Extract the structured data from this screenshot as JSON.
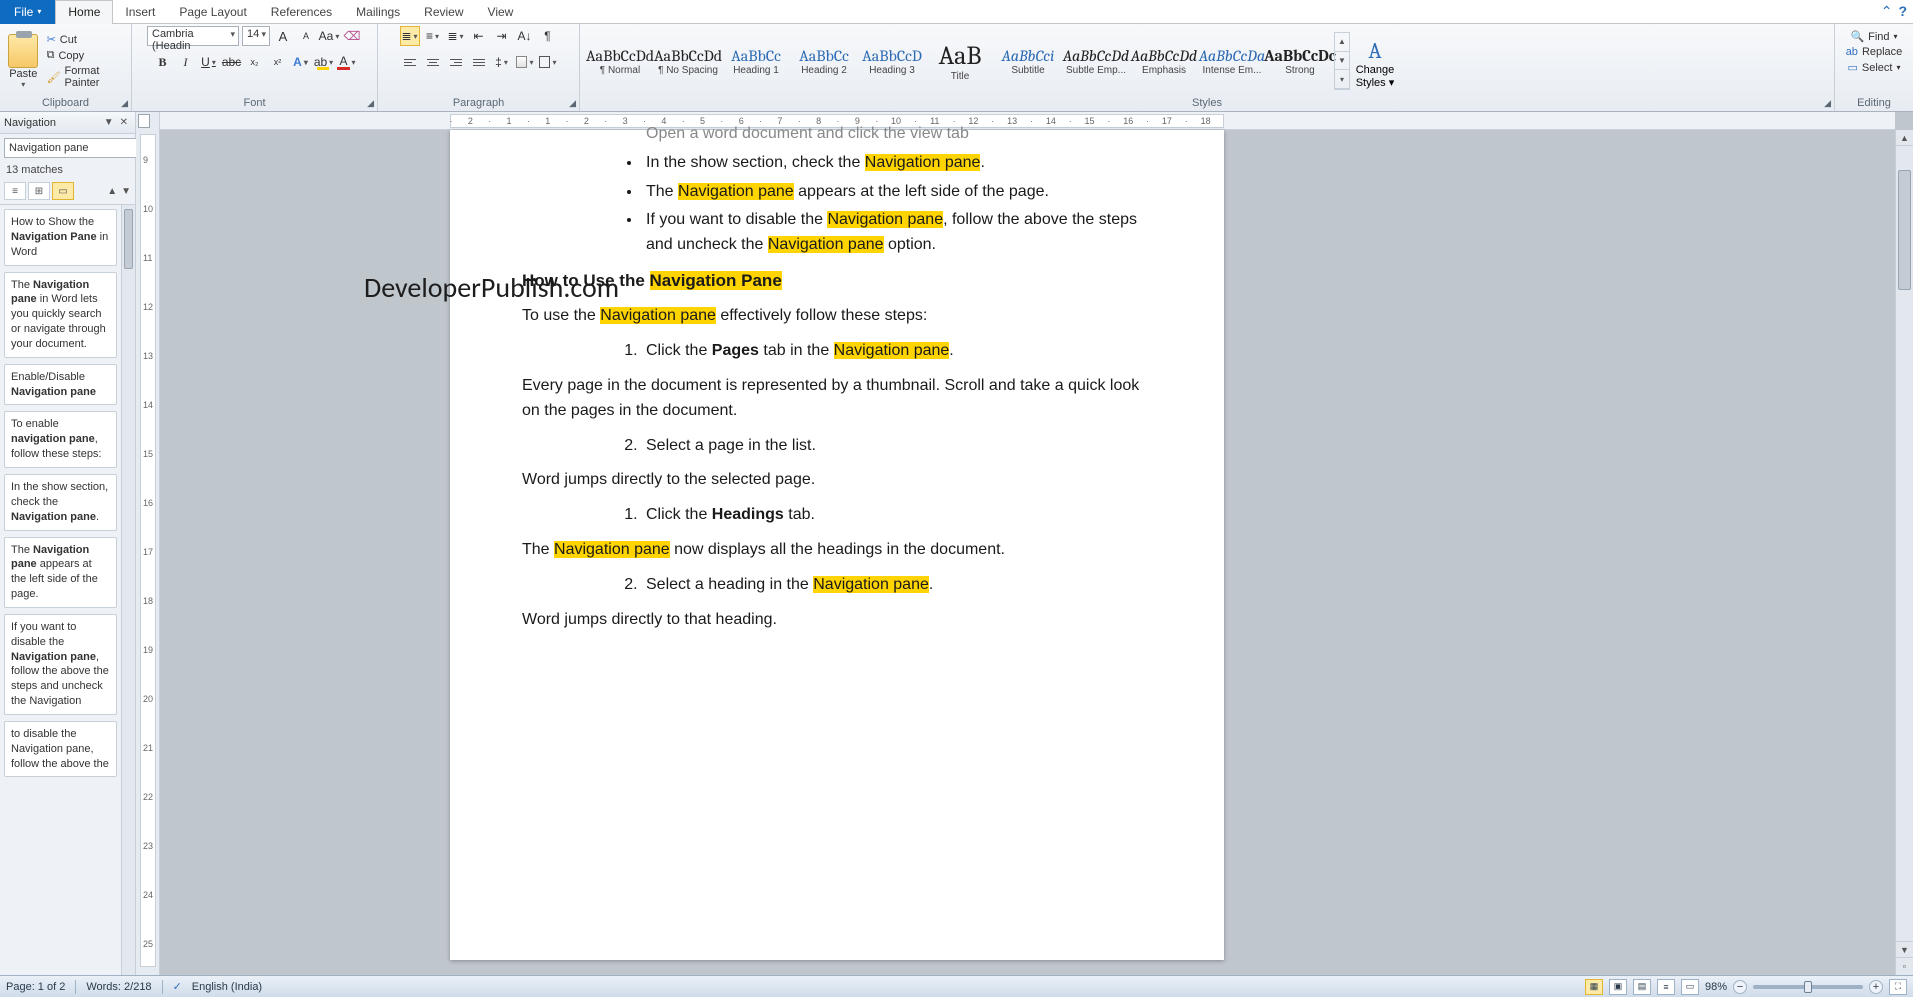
{
  "menu": {
    "file": "File",
    "tabs": [
      "Home",
      "Insert",
      "Page Layout",
      "References",
      "Mailings",
      "Review",
      "View"
    ],
    "active": "Home"
  },
  "ribbon": {
    "clipboard": {
      "label": "Clipboard",
      "paste": "Paste",
      "cut": "Cut",
      "copy": "Copy",
      "formatPainter": "Format Painter"
    },
    "font": {
      "label": "Font",
      "name": "Cambria (Headin",
      "size": "14"
    },
    "paragraph": {
      "label": "Paragraph"
    },
    "styles": {
      "label": "Styles",
      "changeStyles": "Change Styles",
      "items": [
        {
          "preview": "AaBbCcDd",
          "class": "",
          "name": "¶ Normal"
        },
        {
          "preview": "AaBbCcDd",
          "class": "",
          "name": "¶ No Spacing"
        },
        {
          "preview": "AaBbCc",
          "class": "blue",
          "name": "Heading 1"
        },
        {
          "preview": "AaBbCc",
          "class": "blue",
          "name": "Heading 2"
        },
        {
          "preview": "AaBbCcD",
          "class": "blue",
          "name": "Heading 3"
        },
        {
          "preview": "AaB",
          "class": "big",
          "name": "Title"
        },
        {
          "preview": "AaBbCci",
          "class": "blue ital",
          "name": "Subtitle"
        },
        {
          "preview": "AaBbCcDd",
          "class": "ital",
          "name": "Subtle Emp..."
        },
        {
          "preview": "AaBbCcDd",
          "class": "ital",
          "name": "Emphasis"
        },
        {
          "preview": "AaBbCcDa",
          "class": "blue ital",
          "name": "Intense Em..."
        },
        {
          "preview": "AaBbCcDc",
          "class": "bold",
          "name": "Strong"
        }
      ]
    },
    "editing": {
      "label": "Editing",
      "find": "Find",
      "replace": "Replace",
      "select": "Select"
    }
  },
  "navPane": {
    "title": "Navigation",
    "searchValue": "Navigation pane",
    "matches": "13 matches",
    "results": [
      {
        "pre": "How to Show the ",
        "bold": "Navigation Pane",
        "post": " in Word"
      },
      {
        "pre": "The ",
        "bold": "Navigation pane",
        "post": " in Word lets you quickly search or navigate through your document."
      },
      {
        "pre": "Enable/Disable ",
        "bold": "Navigation pane",
        "post": ""
      },
      {
        "pre": "To enable ",
        "bold": "navigation pane",
        "post": ", follow these steps:"
      },
      {
        "pre": "In the show section, check the ",
        "bold": "Navigation pane",
        "post": "."
      },
      {
        "pre": "The ",
        "bold": "Navigation pane",
        "post": " appears at the left side of the page."
      },
      {
        "pre": "If you want to disable the ",
        "bold": "Navigation pane",
        "post": ", follow the above the steps and uncheck the Navigation"
      },
      {
        "pre": "to disable the Navigation pane, follow the above the",
        "bold": "",
        "post": ""
      }
    ]
  },
  "hruler": {
    "marks": [
      "2",
      "1",
      "1",
      "2",
      "3",
      "4",
      "5",
      "6",
      "7",
      "8",
      "9",
      "10",
      "11",
      "12",
      "13",
      "14",
      "15",
      "16",
      "17",
      "18"
    ]
  },
  "vruler": {
    "marks": [
      "9",
      "10",
      "11",
      "12",
      "13",
      "14",
      "15",
      "16",
      "17",
      "18",
      "19",
      "20",
      "21",
      "22",
      "23",
      "24",
      "25"
    ]
  },
  "watermark": "DeveloperPublish.com",
  "doc": {
    "bul_truncated": "Open a word document and click the view tab",
    "bul1_a": "In the show section, check the ",
    "bul1_h": "Navigation pane",
    "bul1_b": ".",
    "bul2_a": "The ",
    "bul2_h": "Navigation pane",
    "bul2_b": " appears at the left side of the page.",
    "bul3_a": "If you want to disable the ",
    "bul3_h": "Navigation pane",
    "bul3_b": ", follow the above the steps and uncheck the ",
    "bul3_h2": "Navigation pane",
    "bul3_c": " option.",
    "h3_a": "How to Use the ",
    "h3_h": "Navigation Pane",
    "p1_a": "To use the ",
    "p1_h": "Navigation pane",
    "p1_b": " effectively follow these steps:",
    "ol1_a": "Click the ",
    "ol1_bold": "Pages",
    "ol1_b": " tab in the ",
    "ol1_h": "Navigation pane",
    "ol1_c": ".",
    "p2": "Every page in the document is represented by a thumbnail. Scroll and take a quick look on the pages in the document.",
    "ol2": "Select a page in the list.",
    "p3": "Word jumps directly to the selected page.",
    "ol3_a": "Click the ",
    "ol3_bold": "Headings",
    "ol3_b": " tab.",
    "p4_a": "The ",
    "p4_h": "Navigation pane",
    "p4_b": " now displays all the headings in the document.",
    "ol4_a": "Select a heading in the ",
    "ol4_h": "Navigation pane",
    "ol4_b": ".",
    "p5": "Word jumps directly to that heading."
  },
  "status": {
    "page": "Page: 1 of 2",
    "words": "Words: 2/218",
    "lang": "English (India)",
    "zoom": "98%"
  }
}
